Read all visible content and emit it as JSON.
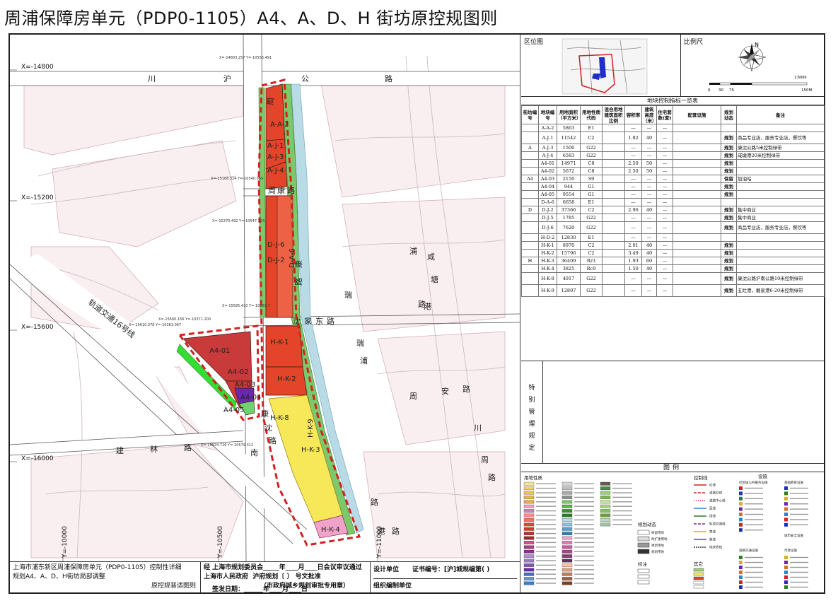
{
  "page_title": "周浦保障房单元（PDP0-1105）A4、A、D、H 街坊原控规图则",
  "map": {
    "x_coords": [
      "X=-14800",
      "X=-15200",
      "X=-15600",
      "X=-16000"
    ],
    "y_coords": [
      "Y=-10000",
      "Y=-10500",
      "Y=-11000"
    ],
    "point_coords": [
      "X=-14803.257 Y=-10555.491",
      "X=-15108.324 Y=-10540.069",
      "X=-15370.492 Y=-10547.323",
      "X=-15585.410 Y=-10581.7",
      "X=-15600.156 Y=-10371.200",
      "X=-15610.378 Y=-10363.067",
      "X=-15924.726 Y=-10579.312"
    ],
    "roads": {
      "north": [
        "川",
        "沪",
        "公",
        "路"
      ],
      "middle": [
        "周",
        "康",
        "路"
      ],
      "south_middle": [
        "沈",
        "家",
        "东",
        "路"
      ],
      "south": [
        "建",
        "林",
        "路"
      ],
      "rail": "轨道交通16号线",
      "east_1": [
        "瑞",
        "浦",
        "路"
      ],
      "east_2": [
        "周",
        "安",
        "路"
      ],
      "east_3": [
        "瑞",
        "浦",
        "路"
      ],
      "east_4": [
        "川",
        "周",
        "路"
      ],
      "east_5": [
        "港",
        "路"
      ],
      "river_1": [
        "咸",
        "塘",
        "港"
      ],
      "river_2": [
        "康",
        "沈",
        "路"
      ],
      "river_3": [
        "南"
      ],
      "inner": [
        "周",
        "康",
        "路"
      ]
    },
    "parcels": [
      "A-A-2",
      "A-J-1",
      "A-J-3",
      "A-J-4",
      "D-J-2",
      "D-J-6",
      "D-A-6",
      "A4-01",
      "A4-02",
      "A4-03",
      "A4-04",
      "A4-05",
      "H-K-1",
      "H-K-2",
      "H-K-3",
      "H-K-4",
      "H-K-9",
      "H-K-8"
    ]
  },
  "infobar": {
    "plan_line1": "上海市浦东新区周浦保障房单元（PDP0-1105）控制性详细",
    "plan_line2": "规划A4、A、D、H街坊局部调整",
    "plan_line3": "原控规普适图则",
    "approve_prefix": "经",
    "approve_line1": "上海市规划委员会_____年____月____日会议审议通过",
    "approve_line2a": "上海市人民政府",
    "approve_line2b": "沪府规划〔        〕         号文批准",
    "approve_line3": "（市政府城乡规划审批专用章）",
    "approve_line4": "签发日期：______年____月____日",
    "design_unit": "设计单位",
    "cert_no": "证书编号：[沪]城规编第(          )",
    "org_unit": "组织编制单位"
  },
  "panel": {
    "location_title": "区位图",
    "scale_title": "比例尺",
    "scale_ratio": "1:6000",
    "scale_ticks": [
      "0",
      "30",
      "75",
      "150M"
    ],
    "north": "N",
    "table_title": "地块控制指标一览表",
    "headers": [
      "街坊编号",
      "地块编号",
      "用地面积（平方米）",
      "用地性质代码",
      "混合用地建筑面积比例",
      "容积率",
      "建筑高度（米）",
      "住宅套数(套)",
      "配套设施",
      "规划动态",
      "备注"
    ],
    "rows": [
      {
        "block": "",
        "id": "A-A-2",
        "area": "5863",
        "code": "E1",
        "mix": "",
        "far": "—",
        "h": "—",
        "units": "—",
        "fac": "",
        "dyn": "",
        "note": ""
      },
      {
        "block": "",
        "id": "A-J-1",
        "area": "11542",
        "code": "C2",
        "mix": "",
        "far": "1.82",
        "h": "40",
        "units": "—",
        "fac": "",
        "dyn": "规划",
        "note": "商品专业店，服务专业店，餐饮等",
        "tall": true
      },
      {
        "block": "A",
        "id": "A-J-3",
        "area": "1500",
        "code": "G22",
        "mix": "",
        "far": "—",
        "h": "—",
        "units": "—",
        "fac": "",
        "dyn": "规划",
        "note": "康沈公路5米控制绿带"
      },
      {
        "block": "",
        "id": "A-J-4",
        "area": "6583",
        "code": "G22",
        "mix": "",
        "far": "—",
        "h": "—",
        "units": "—",
        "fac": "",
        "dyn": "规划",
        "note": "咸塘港20米控制绿带"
      },
      {
        "block": "",
        "id": "A4-01",
        "area": "14971",
        "code": "C8",
        "mix": "",
        "far": "2.50",
        "h": "50",
        "units": "—",
        "fac": "",
        "dyn": "规划",
        "note": ""
      },
      {
        "block": "",
        "id": "A4-02",
        "area": "5672",
        "code": "C8",
        "mix": "",
        "far": "2.50",
        "h": "50",
        "units": "—",
        "fac": "",
        "dyn": "规划",
        "note": ""
      },
      {
        "block": "A4",
        "id": "A4-03",
        "area": "2150",
        "code": "S9",
        "mix": "",
        "far": "—",
        "h": "—",
        "units": "—",
        "fac": "",
        "dyn": "保留",
        "note": "加油站"
      },
      {
        "block": "",
        "id": "A4-04",
        "area": "944",
        "code": "G1",
        "mix": "",
        "far": "—",
        "h": "—",
        "units": "—",
        "fac": "",
        "dyn": "规划",
        "note": ""
      },
      {
        "block": "",
        "id": "A4-05",
        "area": "9554",
        "code": "G1",
        "mix": "",
        "far": "—",
        "h": "—",
        "units": "—",
        "fac": "",
        "dyn": "规划",
        "note": ""
      },
      {
        "block": "",
        "id": "D-A-6",
        "area": "6658",
        "code": "E1",
        "mix": "",
        "far": "—",
        "h": "—",
        "units": "—",
        "fac": "",
        "dyn": "",
        "note": ""
      },
      {
        "block": "D",
        "id": "D-J-2",
        "area": "37366",
        "code": "C2",
        "mix": "",
        "far": "2.96",
        "h": "40",
        "units": "—",
        "fac": "",
        "dyn": "规划",
        "note": "集中商业"
      },
      {
        "block": "",
        "id": "D-J-5",
        "area": "1785",
        "code": "G22",
        "mix": "",
        "far": "—",
        "h": "—",
        "units": "—",
        "fac": "",
        "dyn": "规划",
        "note": "集中商业"
      },
      {
        "block": "",
        "id": "D-J-6",
        "area": "7620",
        "code": "G22",
        "mix": "",
        "far": "—",
        "h": "—",
        "units": "—",
        "fac": "",
        "dyn": "规划",
        "note": "商品专业店，服务专业店，餐饮等",
        "tall": true
      },
      {
        "block": "",
        "id": "H-D-2",
        "area": "12830",
        "code": "E1",
        "mix": "",
        "far": "—",
        "h": "—",
        "units": "—",
        "fac": "",
        "dyn": "",
        "note": ""
      },
      {
        "block": "",
        "id": "H-K-1",
        "area": "8970",
        "code": "C2",
        "mix": "",
        "far": "2.01",
        "h": "40",
        "units": "—",
        "fac": "",
        "dyn": "规划",
        "note": ""
      },
      {
        "block": "",
        "id": "H-K-2",
        "area": "15796",
        "code": "C2",
        "mix": "",
        "far": "3.49",
        "h": "40",
        "units": "—",
        "fac": "",
        "dyn": "规划",
        "note": ""
      },
      {
        "block": "H",
        "id": "H-K-3",
        "area": "36409",
        "code": "Rr3",
        "mix": "",
        "far": "1.93",
        "h": "60",
        "units": "—",
        "fac": "",
        "dyn": "规划",
        "note": ""
      },
      {
        "block": "",
        "id": "H-K-4",
        "area": "3825",
        "code": "Rc9",
        "mix": "",
        "far": "1.50",
        "h": "40",
        "units": "—",
        "fac": "",
        "dyn": "规划",
        "note": ""
      },
      {
        "block": "",
        "id": "H-K-8",
        "area": "4917",
        "code": "G22",
        "mix": "",
        "far": "—",
        "h": "—",
        "units": "—",
        "fac": "",
        "dyn": "规划",
        "note": "康沈公路沪南公路10米控制绿带",
        "tall": true
      },
      {
        "block": "",
        "id": "H-K-9",
        "area": "12807",
        "code": "G22",
        "mix": "",
        "far": "—",
        "h": "—",
        "units": "—",
        "fac": "",
        "dyn": "规划",
        "note": "五灶港，戴家港6-20米控制绿带",
        "tall": true
      }
    ],
    "special_title": [
      "特",
      "别",
      "管",
      "理",
      "规",
      "定"
    ],
    "legend_title": "图例",
    "legend_heads": [
      "用地性质",
      "规划动态",
      "标注",
      "控制线",
      "其它",
      "设施"
    ],
    "legend_sub": [
      "社区级公共服务设施",
      "基础教育设施",
      "城市安全设施",
      "道路交通设施",
      "市政设施"
    ],
    "legend_dyn": [
      "保留用地",
      "改扩建用地",
      "更新用地",
      "规划用地"
    ],
    "legend_control": [
      "红线",
      "道路红线",
      "道路中心线",
      "蓝线",
      "绿线",
      "轨道交通线",
      "黄线",
      "紫线",
      "地块界线"
    ]
  }
}
